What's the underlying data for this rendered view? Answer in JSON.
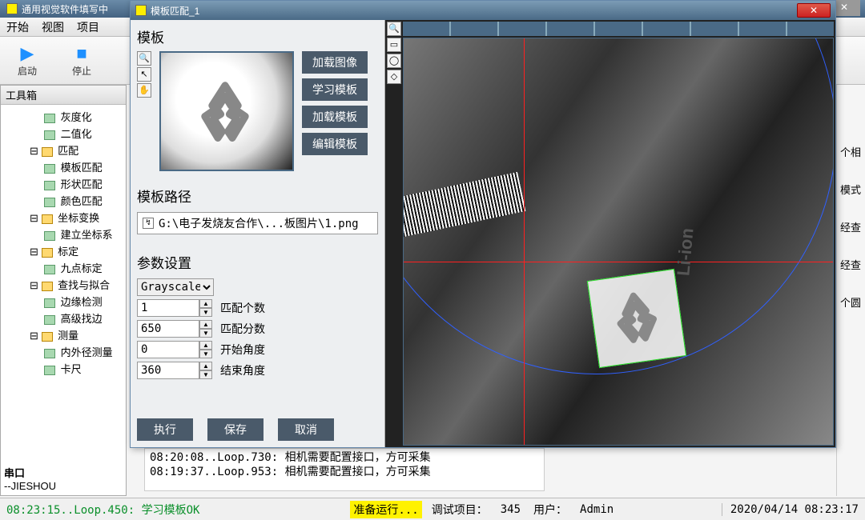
{
  "main_window": {
    "title": "通用视觉软件填写中"
  },
  "menubar": {
    "start": "开始",
    "view": "视图",
    "item": "项目"
  },
  "toolbar": {
    "run": "启动",
    "stop": "停止"
  },
  "toolbox": {
    "title": "工具箱",
    "items": [
      {
        "label": "灰度化",
        "lv": 3
      },
      {
        "label": "二值化",
        "lv": 3
      },
      {
        "label": "匹配",
        "lv": 2,
        "folder": true
      },
      {
        "label": "模板匹配",
        "lv": 3
      },
      {
        "label": "形状匹配",
        "lv": 3
      },
      {
        "label": "颜色匹配",
        "lv": 3
      },
      {
        "label": "坐标变换",
        "lv": 2,
        "folder": true
      },
      {
        "label": "建立坐标系",
        "lv": 3
      },
      {
        "label": "标定",
        "lv": 2,
        "folder": true
      },
      {
        "label": "九点标定",
        "lv": 3
      },
      {
        "label": "查找与拟合",
        "lv": 2,
        "folder": true
      },
      {
        "label": "边缘检测",
        "lv": 3
      },
      {
        "label": "高级找边",
        "lv": 3
      },
      {
        "label": "测量",
        "lv": 2,
        "folder": true
      },
      {
        "label": "内外径测量",
        "lv": 3
      },
      {
        "label": "卡尺",
        "lv": 3
      }
    ]
  },
  "serial": {
    "title": "串口",
    "value": "--JIESHOU"
  },
  "right_strip": {
    "a": "个相",
    "b": "模式",
    "c": "经查",
    "d": "经查",
    "e": "个圆"
  },
  "log": {
    "line1": "08:20:08..Loop.730:   相机需要配置接口，方可采集",
    "line2": "08:19:37..Loop.953:   相机需要配置接口，方可采集"
  },
  "status": {
    "left": "08:23:15..Loop.450: 学习模板OK",
    "ready": "准备运行...",
    "debug_label": "调试项目：",
    "debug_value": "345",
    "user_label": "用户：",
    "user_value": "Admin",
    "time": "2020/04/14 08:23:17"
  },
  "dialog": {
    "title": "模板匹配_1",
    "template_label": "模板",
    "buttons": {
      "load_image": "加载图像",
      "learn": "学习模板",
      "load_template": "加载模板",
      "edit": "编辑模板"
    },
    "path_label": "模板路径",
    "path_value": "G:\\电子发烧友合作\\...板图片\\1.png",
    "param_label": "参数设置",
    "params": {
      "mode": "Grayscale",
      "match_count": {
        "value": "1",
        "label": "匹配个数"
      },
      "match_score": {
        "value": "650",
        "label": "匹配分数"
      },
      "start_angle": {
        "value": "0",
        "label": "开始角度"
      },
      "end_angle": {
        "value": "360",
        "label": "结束角度"
      }
    },
    "bottom": {
      "exec": "执行",
      "save": "保存",
      "cancel": "取消"
    },
    "li_ion": "Li-ion"
  }
}
